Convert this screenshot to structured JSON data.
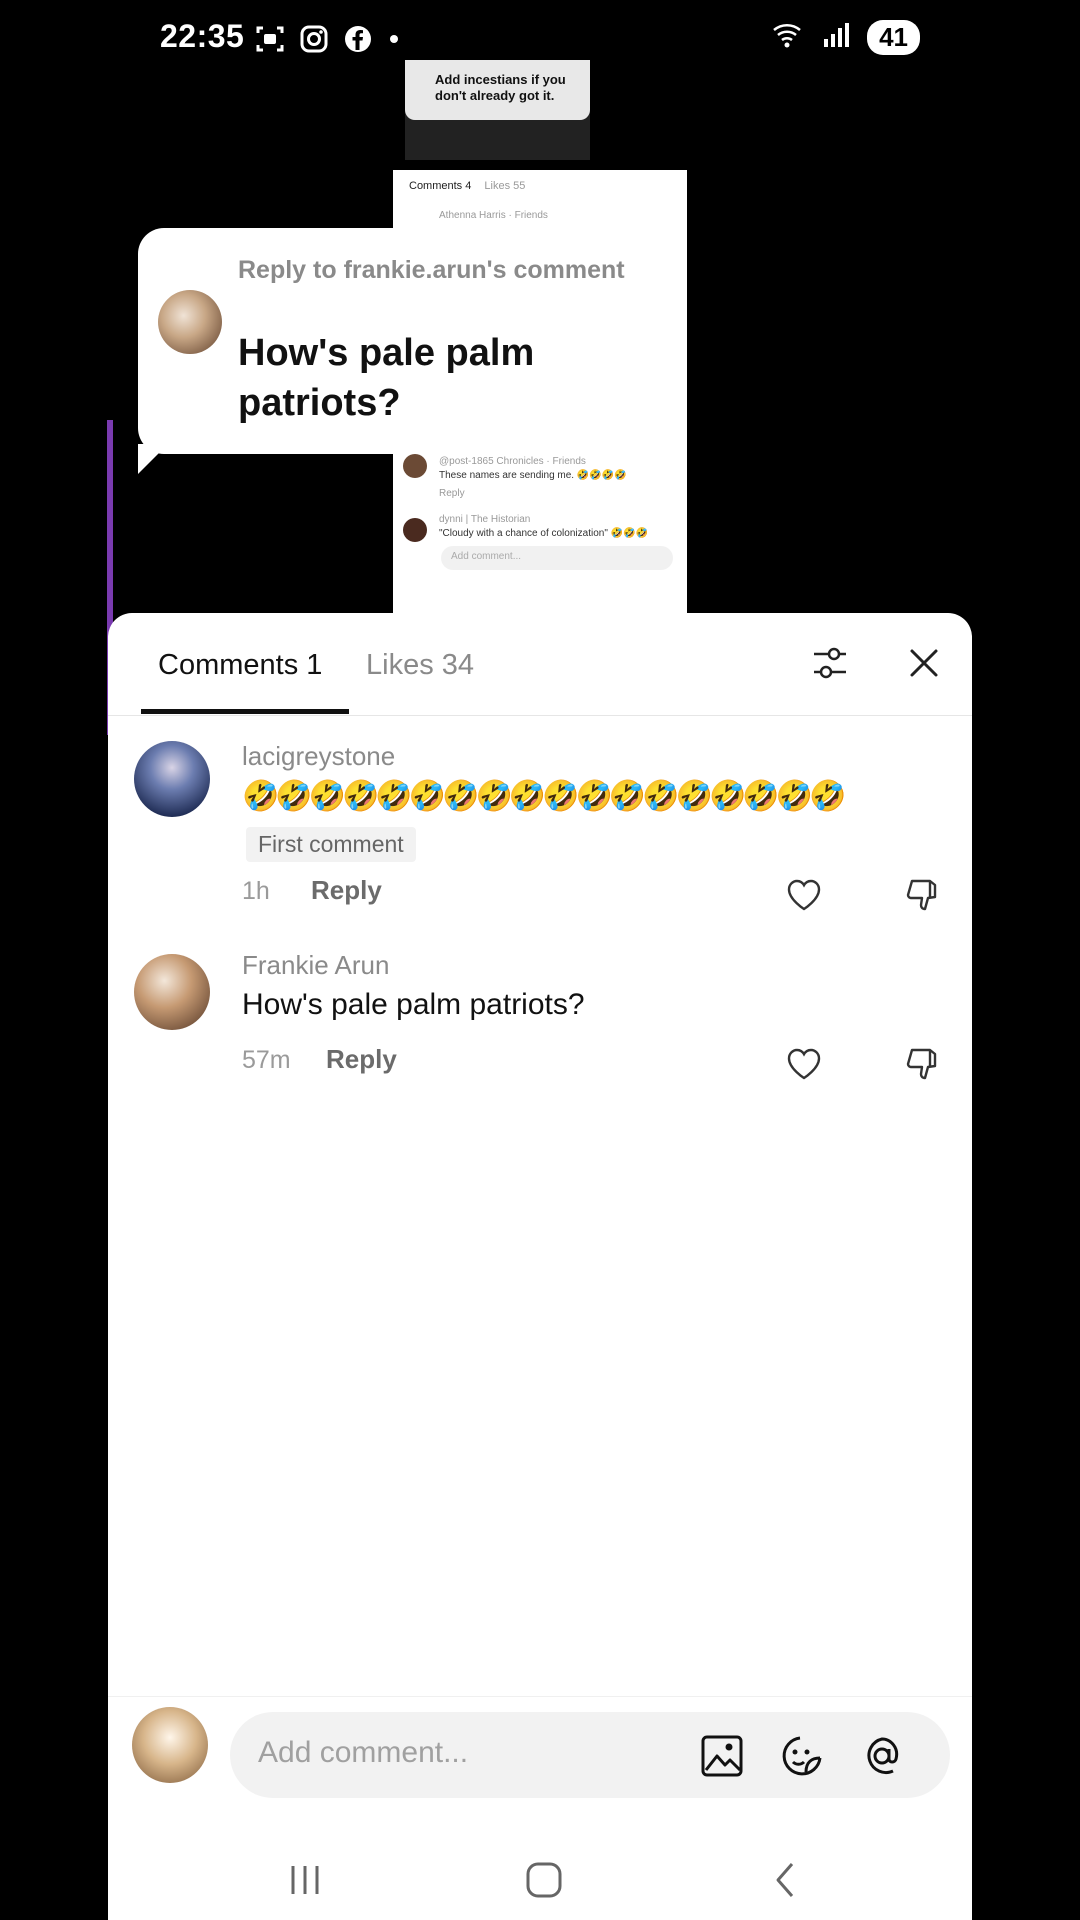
{
  "status_bar": {
    "time": "22:35",
    "battery": "41",
    "left_icons": [
      "screenshot-icon",
      "instagram-icon",
      "facebook-icon",
      "dot-icon"
    ],
    "right_icons": [
      "wifi-icon",
      "signal-icon"
    ]
  },
  "background_video": {
    "top_bubble_text": "Add incestians if you don't already got it.",
    "mini_tabs": {
      "comments": "Comments 4",
      "likes": "Likes 55"
    },
    "mini_lines": [
      "Athenna Harris · Friends",
      "@post-1865 Chronicles · Friends",
      "These names are sending me. 🤣🤣🤣🤣",
      "Reply",
      "dynni | The Historian",
      "\"Cloudy with a chance of colonization\" 🤣🤣🤣"
    ],
    "mini_input_placeholder": "Add comment..."
  },
  "reply_bubble": {
    "label": "Reply to frankie.arun's comment",
    "text": "How's pale palm patriots?"
  },
  "sheet": {
    "tabs": {
      "comments": "Comments 1",
      "likes": "Likes 34"
    },
    "comments": [
      {
        "username": "lacigreystone",
        "text": "🤣🤣🤣🤣🤣🤣🤣🤣🤣🤣🤣🤣🤣🤣🤣🤣🤣🤣",
        "badge": "First comment",
        "time": "1h",
        "reply_label": "Reply"
      },
      {
        "username": "Frankie Arun",
        "text": "How's pale palm patriots?",
        "time": "57m",
        "reply_label": "Reply"
      }
    ],
    "input_placeholder": "Add comment..."
  }
}
